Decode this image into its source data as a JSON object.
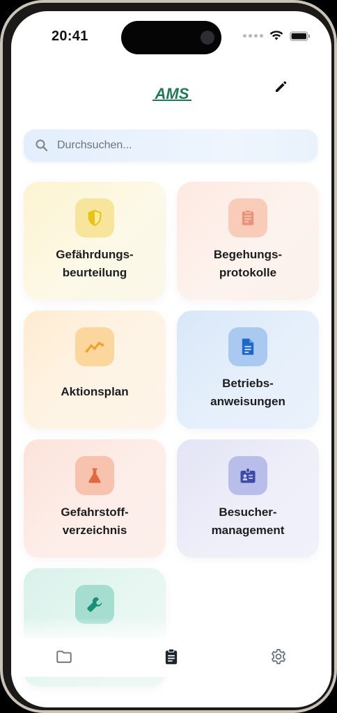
{
  "status_bar": {
    "time": "20:41"
  },
  "header": {
    "logo_text": "AMS",
    "edit_icon": "pencil-icon"
  },
  "search": {
    "placeholder": "Durchsuchen...",
    "value": ""
  },
  "tiles": [
    {
      "label": "Gefährdungs-\nbeurteilung",
      "icon": "shield-icon",
      "color": "#e8c214"
    },
    {
      "label": "Begehungs-\nprotokolle",
      "icon": "clipboard-icon",
      "color": "#e8937a"
    },
    {
      "label": "Aktionsplan",
      "icon": "trend-icon",
      "color": "#f0a12a"
    },
    {
      "label": "Betriebs-\nanweisungen",
      "icon": "document-icon",
      "color": "#1e66c9"
    },
    {
      "label": "Gefahrstoff-\nverzeichnis",
      "icon": "flask-icon",
      "color": "#e2683e"
    },
    {
      "label": "Besucher-\nmanagement",
      "icon": "badge-icon",
      "color": "#3e4aa8"
    },
    {
      "label": "",
      "icon": "wrench-icon",
      "color": "#1b8e78"
    }
  ],
  "tabbar": {
    "items": [
      {
        "icon": "folder-icon",
        "active": false
      },
      {
        "icon": "clipboard-list-icon",
        "active": true
      },
      {
        "icon": "gear-icon",
        "active": false
      }
    ]
  },
  "colors": {
    "brand_green": "#1f7a53",
    "active_tab": "#1c2430",
    "inactive_tab": "#6e7580"
  }
}
